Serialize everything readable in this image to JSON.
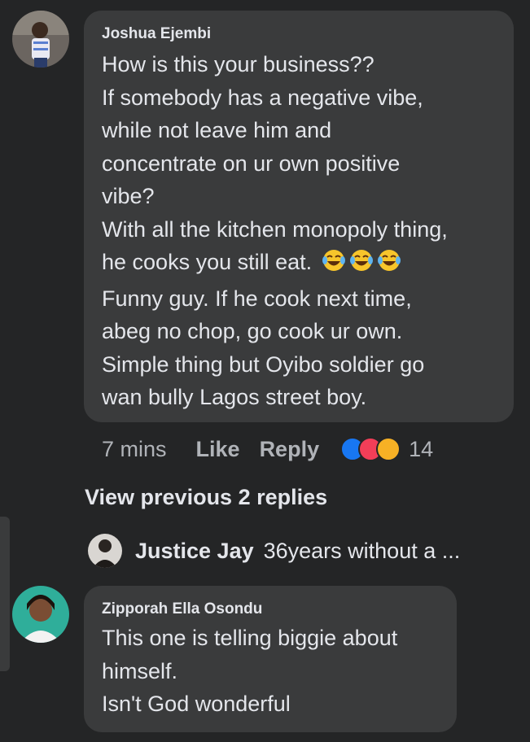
{
  "comment1": {
    "author": "Joshua Ejembi",
    "lines": [
      "How is this your business??",
      "If somebody has a negative vibe,",
      "while not leave him and",
      "concentrate on ur own positive",
      "vibe?",
      "With all the kitchen monopoly thing,",
      "he cooks you still eat.",
      "Funny guy. If he cook next time,",
      "abeg no chop, go cook ur own.",
      "Simple thing but Oyibo soldier go",
      "wan bully Lagos street boy."
    ],
    "emoji": "face-with-tears-of-joy-icon x3",
    "time": "7 mins",
    "like_label": "Like",
    "reply_label": "Reply",
    "reaction_count": "14"
  },
  "view_previous": "View previous 2 replies",
  "reply_preview": {
    "name": "Justice Jay",
    "snippet": "36years without a ..."
  },
  "comment2": {
    "author": "Zipporah Ella Osondu",
    "lines": [
      "This one is telling biggie about",
      "himself.",
      "Isn't God wonderful"
    ]
  },
  "colors": {
    "background": "#242526",
    "bubble": "#3a3b3c",
    "text": "#e4e6eb",
    "muted": "#b0b3b8",
    "like_blue": "#1877f2",
    "love_red": "#f33e58",
    "haha_yellow": "#f7b125"
  }
}
